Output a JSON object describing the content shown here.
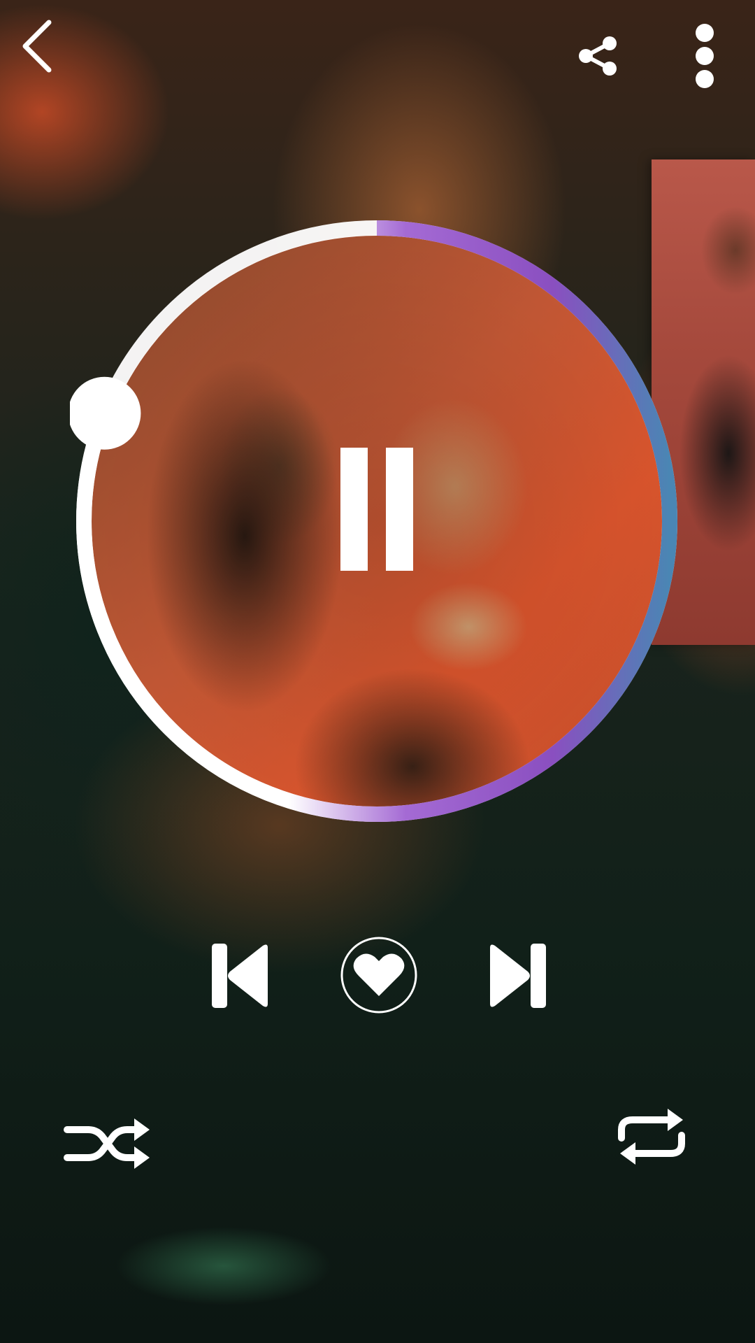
{
  "app": {
    "screen": "music-player-now-playing"
  },
  "colors": {
    "ring_track": "#ffffff",
    "ring_gradient_start": "#9b5fd0",
    "ring_gradient_end": "#4a86b4",
    "icons": "#ffffff"
  },
  "playback": {
    "state": "playing",
    "progress_fraction": 0.81
  },
  "icons": {
    "back": "back-arrow-icon",
    "share": "share-icon",
    "more": "more-vertical-icon",
    "pause": "pause-icon",
    "previous": "skip-previous-icon",
    "favorite": "heart-icon",
    "next": "skip-next-icon",
    "shuffle": "shuffle-icon",
    "repeat": "repeat-icon"
  }
}
